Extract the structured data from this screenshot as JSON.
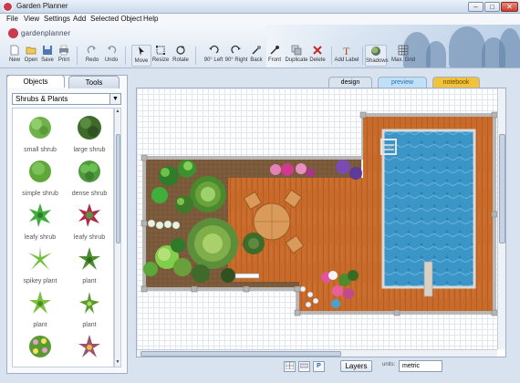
{
  "window": {
    "title": "Garden Planner",
    "min": "–",
    "max": "□",
    "close": "✕"
  },
  "menu": [
    "File",
    "View",
    "Settings",
    "Add",
    "Selected Object",
    "Help"
  ],
  "brand": {
    "logo_text": "gardenplanner",
    "accent": "#c93a4d"
  },
  "toolbar": {
    "buttons": [
      {
        "label": "New",
        "icon": "new-file-icon"
      },
      {
        "label": "Open",
        "icon": "open-folder-icon"
      },
      {
        "label": "Save",
        "icon": "save-icon"
      },
      {
        "label": "Print",
        "icon": "print-icon"
      },
      {
        "label": "Redo",
        "icon": "redo-icon"
      },
      {
        "label": "Undo",
        "icon": "undo-icon"
      },
      {
        "label": "Move",
        "icon": "move-cursor-icon"
      },
      {
        "label": "Resize",
        "icon": "resize-icon"
      },
      {
        "label": "Rotate",
        "icon": "rotate-icon"
      },
      {
        "label": "90° Left",
        "icon": "rotate-left-icon"
      },
      {
        "label": "90° Right",
        "icon": "rotate-right-icon"
      },
      {
        "label": "Back",
        "icon": "send-back-icon"
      },
      {
        "label": "Front",
        "icon": "bring-front-icon"
      },
      {
        "label": "Duplicate",
        "icon": "duplicate-icon"
      },
      {
        "label": "Delete",
        "icon": "delete-icon"
      },
      {
        "label": "Add Label",
        "icon": "add-label-icon"
      },
      {
        "label": "Shadows",
        "icon": "shadows-icon"
      },
      {
        "label": "Max. Grid",
        "icon": "grid-icon"
      }
    ]
  },
  "left_panel": {
    "tabs": [
      {
        "label": "Objects",
        "active": true
      },
      {
        "label": "Tools",
        "active": false
      }
    ],
    "category": "Shrubs & Plants",
    "items": [
      {
        "label": "small shrub",
        "color": "#6fb24b"
      },
      {
        "label": "large shrub",
        "color": "#3f6b2a"
      },
      {
        "label": "simple shrub",
        "color": "#5ea83a"
      },
      {
        "label": "dense shrub",
        "color": "#4f9a3c"
      },
      {
        "label": "leafy shrub",
        "color": "#3fae3a"
      },
      {
        "label": "leafy shrub",
        "color": "#b02a4a"
      },
      {
        "label": "spikey plant",
        "color": "#6fbf38"
      },
      {
        "label": "plant",
        "color": "#4d8f2f"
      },
      {
        "label": "plant",
        "color": "#7cc23f"
      },
      {
        "label": "plant",
        "color": "#5a9a34"
      },
      {
        "label": "",
        "color": "#e3a2c8"
      },
      {
        "label": "",
        "color": "#a0506a"
      }
    ]
  },
  "view_tabs": [
    {
      "label": "design",
      "active": true,
      "color": "#ffffff"
    },
    {
      "label": "preview",
      "active": false,
      "color": "#bfe0f6"
    },
    {
      "label": "notebook",
      "active": false,
      "color": "#f2c23a"
    }
  ],
  "status": {
    "layers_label": "Layers",
    "units_label": "units:",
    "units_value": "metric",
    "view_buttons": [
      "grid-view-icon",
      "ruler-view-icon",
      "plant-list-icon"
    ],
    "plant_list_glyph": "P"
  },
  "plan_colors": {
    "soil": "#7a5a3a",
    "deck": "#c86a2a",
    "pool": "#3b95c7",
    "border": "#b8b8b8"
  }
}
